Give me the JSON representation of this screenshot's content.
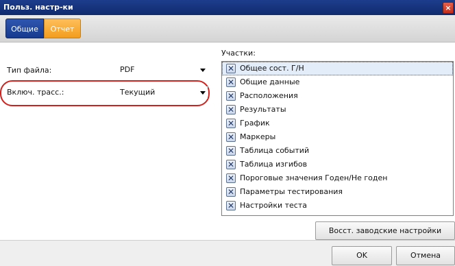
{
  "window": {
    "title": "Польз. настр-ки",
    "close_label": "×"
  },
  "tabs": [
    {
      "label": "Общие",
      "active": true,
      "color": "#1d3f92"
    },
    {
      "label": "Отчет",
      "active": false,
      "color": "#f5a623"
    }
  ],
  "form": {
    "file_type": {
      "label": "Тип файла:",
      "value": "PDF"
    },
    "include_traces": {
      "label": "Включ. трасс.:",
      "value": "Текущий"
    }
  },
  "sections": {
    "label": "Участки:",
    "items": [
      {
        "label": "Общее сост. Г/Н",
        "checked": true
      },
      {
        "label": "Общие данные",
        "checked": true
      },
      {
        "label": "Расположения",
        "checked": true
      },
      {
        "label": "Результаты",
        "checked": true
      },
      {
        "label": "График",
        "checked": true
      },
      {
        "label": "Маркеры",
        "checked": true
      },
      {
        "label": "Таблица событий",
        "checked": true
      },
      {
        "label": "Таблица изгибов",
        "checked": true
      },
      {
        "label": "Пороговые значения Годен/Не годен",
        "checked": true
      },
      {
        "label": "Параметры тестирования",
        "checked": true
      },
      {
        "label": "Настройки теста",
        "checked": true
      }
    ]
  },
  "buttons": {
    "restore_defaults": "Восст. заводские настройки",
    "ok": "OK",
    "cancel": "Отмена"
  },
  "colors": {
    "highlight": "#d2201c",
    "titlebar": "#1d3d8c"
  }
}
